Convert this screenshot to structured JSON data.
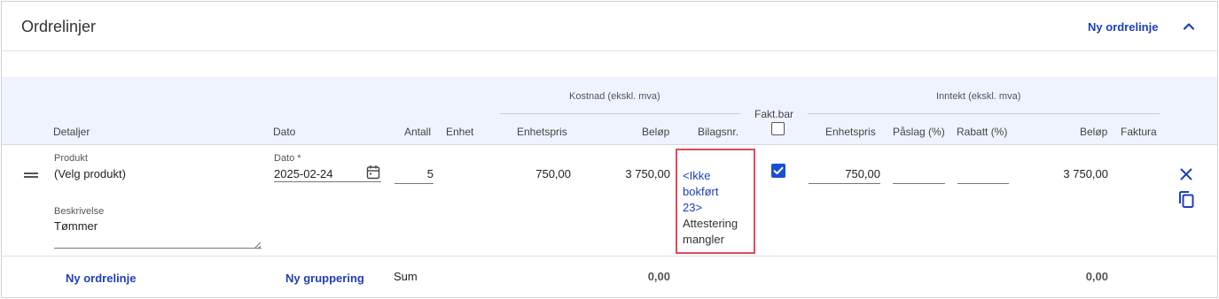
{
  "header": {
    "title": "Ordrelinjer",
    "new_line_label": "Ny ordrelinje",
    "collapse_icon": "chevron-up-icon"
  },
  "table": {
    "group_cost": "Kostnad (ekskl. mva)",
    "group_income": "Inntekt (ekskl. mva)",
    "columns": {
      "details": "Detaljer",
      "date": "Dato",
      "quantity": "Antall",
      "unit": "Enhet",
      "cost_unit_price": "Enhetspris",
      "cost_amount": "Beløp",
      "voucher_no": "Bilagsnr.",
      "invoiceable": "Fakt.bar",
      "income_unit_price": "Enhetspris",
      "markup": "Påslag (%)",
      "discount": "Rabatt (%)",
      "income_amount": "Beløp",
      "invoice": "Faktura"
    }
  },
  "row": {
    "product_label": "Produkt",
    "product_value": "(Velg produkt)",
    "description_label": "Beskrivelse",
    "description_value": "Tømmer",
    "date_label": "Dato *",
    "date_value": "2025-02-24",
    "quantity": "5",
    "cost_unit_price": "750,00",
    "cost_amount": "3 750,00",
    "voucher_link": "<Ikke\nbokført\n23>",
    "voucher_link_lines": [
      "<Ikke",
      "bokført",
      "23>"
    ],
    "voucher_status_lines": [
      "Attestering",
      "mangler"
    ],
    "invoiceable_checked": true,
    "income_unit_price": "750,00",
    "markup": "",
    "discount": "",
    "income_amount": "3 750,00"
  },
  "footer": {
    "new_line_label": "Ny ordrelinje",
    "new_group_label": "Ny gruppering",
    "sum_label": "Sum",
    "cost_sum": "0,00",
    "income_sum": "0,00"
  },
  "colors": {
    "accent": "#1f3fb8",
    "checkbox": "#1a4fd0",
    "highlight_border": "#e24b5b",
    "header_bg": "#eef3fd"
  }
}
